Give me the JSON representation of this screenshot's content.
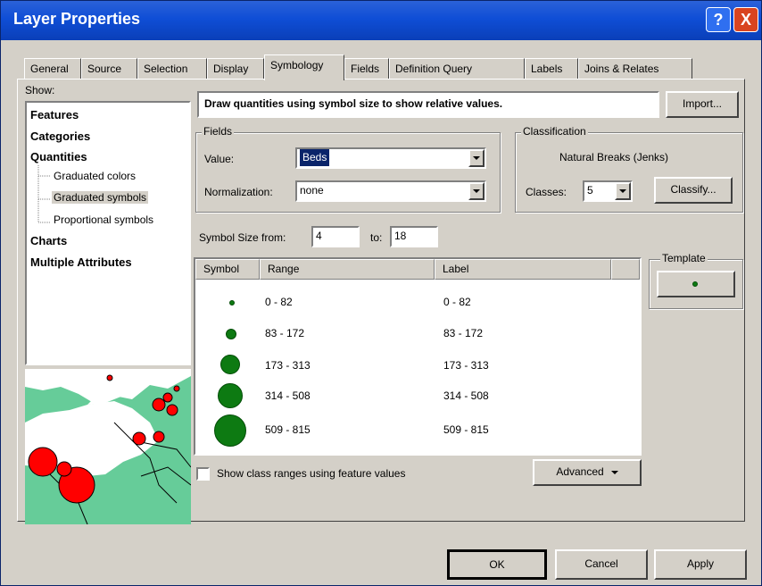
{
  "window": {
    "title": "Layer Properties",
    "help_label": "?",
    "close_label": "X"
  },
  "tabs": [
    "General",
    "Source",
    "Selection",
    "Display",
    "Symbology",
    "Fields",
    "Definition Query",
    "Labels",
    "Joins & Relates"
  ],
  "active_tab": "Symbology",
  "show": {
    "label": "Show:",
    "items": [
      {
        "label": "Features",
        "style": "bold"
      },
      {
        "label": "Categories",
        "style": "bold"
      },
      {
        "label": "Quantities",
        "style": "bold"
      },
      {
        "label": "Graduated colors",
        "style": "sub"
      },
      {
        "label": "Graduated symbols",
        "style": "sub",
        "selected": true
      },
      {
        "label": "Proportional symbols",
        "style": "sub"
      },
      {
        "label": "Charts",
        "style": "bold"
      },
      {
        "label": "Multiple Attributes",
        "style": "bold"
      }
    ]
  },
  "description": "Draw quantities using symbol size to show relative values.",
  "import_button": "Import...",
  "fields": {
    "group_label": "Fields",
    "value_label": "Value:",
    "value": "Beds",
    "normalization_label": "Normalization:",
    "normalization": "none"
  },
  "classification": {
    "group_label": "Classification",
    "method": "Natural Breaks (Jenks)",
    "classes_label": "Classes:",
    "classes": "5",
    "classify_button": "Classify..."
  },
  "symbol_size": {
    "from_label": "Symbol Size from:",
    "from": "4",
    "to_label": "to:",
    "to": "18"
  },
  "table": {
    "headers": [
      "Symbol",
      "Range",
      "Label"
    ],
    "rows": [
      {
        "range": "0 - 82",
        "label": "0 - 82",
        "size": 4
      },
      {
        "range": "83 - 172",
        "label": "83 - 172",
        "size": 7
      },
      {
        "range": "173 - 313",
        "label": "173 - 313",
        "size": 11
      },
      {
        "range": "314 - 508",
        "label": "314 - 508",
        "size": 14
      },
      {
        "range": "509 - 815",
        "label": "509 - 815",
        "size": 18
      }
    ]
  },
  "template": {
    "group_label": "Template"
  },
  "show_class_ranges": {
    "label": "Show class ranges using feature values",
    "checked": false
  },
  "advanced_button": "Advanced",
  "footer": {
    "ok": "OK",
    "cancel": "Cancel",
    "apply": "Apply"
  },
  "colors": {
    "symbol_fill": "#0d7a12",
    "preview_land": "#66cc99",
    "preview_points": "#ff0000",
    "title_bar": "#0f4ed6"
  }
}
